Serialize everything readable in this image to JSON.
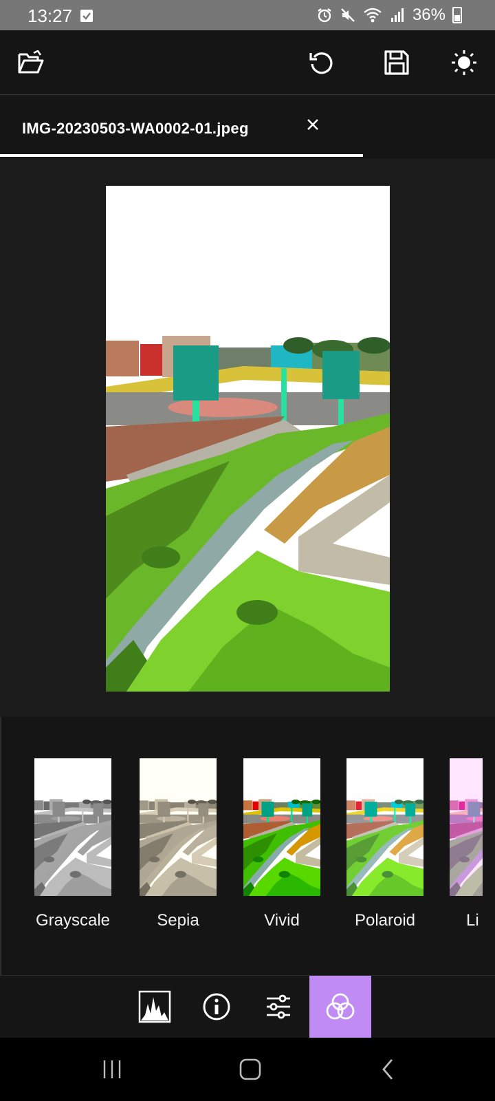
{
  "status_bar": {
    "time": "13:27",
    "battery": "36%",
    "icons": [
      "checkbox-notification-icon",
      "alarm-icon",
      "mute-icon",
      "wifi-icon",
      "signal-icon",
      "battery-icon"
    ]
  },
  "toolbar": {
    "icons": [
      "open-folder-icon",
      "undo-icon",
      "save-icon",
      "brightness-icon"
    ]
  },
  "tab": {
    "filename": "IMG-20230503-WA0002-01.jpeg",
    "close_icon": "close-icon"
  },
  "filters": [
    {
      "label": "Grayscale",
      "style": "grayscale"
    },
    {
      "label": "Sepia",
      "style": "sepia"
    },
    {
      "label": "Vivid",
      "style": "vivid"
    },
    {
      "label": "Polaroid",
      "style": "polaroid"
    },
    {
      "label": "Li",
      "style": "lilac"
    }
  ],
  "bottom_tools": {
    "icons": [
      "histogram-icon",
      "info-icon",
      "adjustments-icon",
      "filters-icon"
    ],
    "active": "filters-icon",
    "accent_color": "#c08cf3"
  },
  "nav_bar": {
    "icons": [
      "recents-icon",
      "home-icon",
      "back-icon"
    ]
  }
}
